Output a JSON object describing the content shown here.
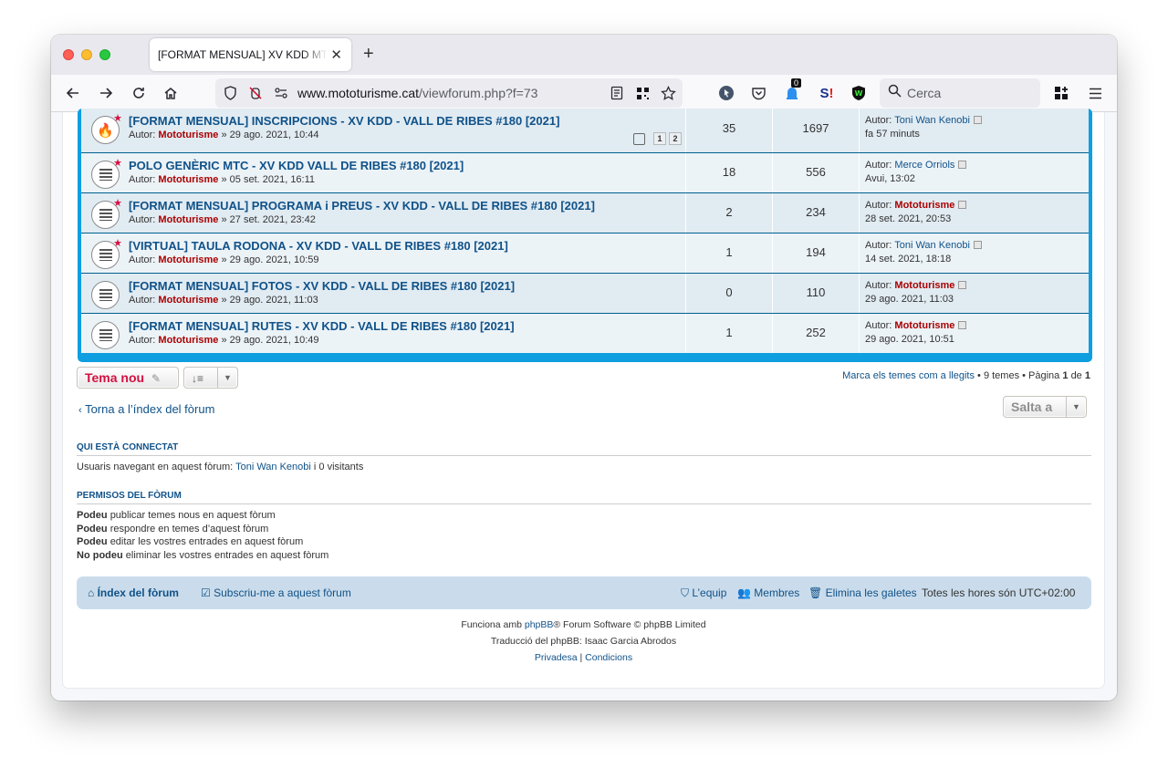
{
  "browser": {
    "tab_title": "[FORMAT MENSUAL] XV KDD MTC | Moto",
    "url_host": "www.mototurisme.cat",
    "url_path": "/viewforum.php?f=73",
    "search_placeholder": "Cerca",
    "notification_count": "0"
  },
  "topics": [
    {
      "title": "[FORMAT MENSUAL] INSCRIPCIONS - XV KDD - VALL DE RIBES #180 [2021]",
      "author_prefix": "Autor:",
      "author": "Mototurisme",
      "date": "» 29 ago. 2021, 10:44",
      "replies": "35",
      "views": "1697",
      "last_author_prefix": "Autor:",
      "last_author": "Toni Wan Kenobi",
      "last_date": "fa 57 minuts",
      "pages": [
        "1",
        "2"
      ],
      "icon": "hot-topic-icon"
    },
    {
      "title": "POLO GENÈRIC MTC - XV KDD VALL DE RIBES #180 [2021]",
      "author_prefix": "Autor:",
      "author": "Mototurisme",
      "date": "» 05 set. 2021, 16:11",
      "replies": "18",
      "views": "556",
      "last_author_prefix": "Autor:",
      "last_author": "Merce Orriols",
      "last_date": "Avui, 13:02",
      "icon": "topic-icon"
    },
    {
      "title": "[FORMAT MENSUAL] PROGRAMA i PREUS - XV KDD - VALL DE RIBES #180 [2021]",
      "author_prefix": "Autor:",
      "author": "Mototurisme",
      "date": "» 27 set. 2021, 23:42",
      "replies": "2",
      "views": "234",
      "last_author_prefix": "Autor:",
      "last_author": "Mototurisme",
      "last_date": "28 set. 2021, 20:53",
      "icon": "topic-icon"
    },
    {
      "title": "[VIRTUAL] TAULA RODONA - XV KDD - VALL DE RIBES #180 [2021]",
      "author_prefix": "Autor:",
      "author": "Mototurisme",
      "date": "» 29 ago. 2021, 10:59",
      "replies": "1",
      "views": "194",
      "last_author_prefix": "Autor:",
      "last_author": "Toni Wan Kenobi",
      "last_date": "14 set. 2021, 18:18",
      "icon": "topic-icon"
    },
    {
      "title": "[FORMAT MENSUAL] FOTOS - XV KDD - VALL DE RIBES #180 [2021]",
      "author_prefix": "Autor:",
      "author": "Mototurisme",
      "date": "» 29 ago. 2021, 11:03",
      "replies": "0",
      "views": "110",
      "last_author_prefix": "Autor:",
      "last_author": "Mototurisme",
      "last_date": "29 ago. 2021, 11:03",
      "icon": "topic-icon"
    },
    {
      "title": "[FORMAT MENSUAL] RUTES - XV KDD - VALL DE RIBES #180 [2021]",
      "author_prefix": "Autor:",
      "author": "Mototurisme",
      "date": "» 29 ago. 2021, 10:49",
      "replies": "1",
      "views": "252",
      "last_author_prefix": "Autor:",
      "last_author": "Mototurisme",
      "last_date": "29 ago. 2021, 10:51",
      "icon": "topic-icon"
    }
  ],
  "actions": {
    "new_topic": "Tema nou",
    "mark_read": "Marca els temes com a llegits",
    "topic_count": "• 9 temes • Pàgina",
    "page_current": "1",
    "page_of": "de",
    "page_total": "1",
    "back": "Torna a l’índex del fòrum",
    "jump_to": "Salta a"
  },
  "online": {
    "title": "QUI ESTÀ CONNECTAT",
    "text_prefix": "Usuaris navegant en aquest fòrum:",
    "user": "Toni Wan Kenobi",
    "text_suffix": "i 0 visitants"
  },
  "permissions": {
    "title": "PERMISOS DEL FÒRUM",
    "lines": [
      {
        "verb": "Podeu",
        "text": "publicar temes nous en aquest fòrum"
      },
      {
        "verb": "Podeu",
        "text": "respondre en temes d’aquest fòrum"
      },
      {
        "verb": "Podeu",
        "text": "editar les vostres entrades en aquest fòrum"
      },
      {
        "verb": "No podeu",
        "text": "eliminar les vostres entrades en aquest fòrum"
      }
    ]
  },
  "footer_nav": {
    "index": "Índex del fòrum",
    "subscribe": "Subscriu-me a aquest fòrum",
    "team": "L’equip",
    "members": "Membres",
    "delete_cookies": "Elimina les galetes",
    "timezone": "Totes les hores són UTC+02:00"
  },
  "copyright": {
    "line1_prefix": "Funciona amb",
    "line1_link": "phpBB",
    "line1_suffix": "® Forum Software © phpBB Limited",
    "line2": "Traducció del phpBB: Isaac Garcia Abrodos",
    "privacy": "Privadesa",
    "separator": "|",
    "terms": "Condicions"
  },
  "colors": {
    "accent_blue": "#105289",
    "forum_border": "#0f9ee0",
    "author_red": "#aa0000",
    "new_topic_red": "#d31141"
  }
}
